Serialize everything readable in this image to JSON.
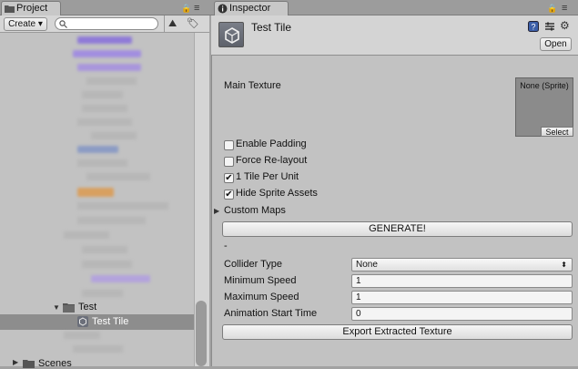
{
  "project_tab": {
    "title": "Project"
  },
  "project_toolbar": {
    "create_label": "Create"
  },
  "project_tree": {
    "folder_label": "Test",
    "selected_item_label": "Test Tile",
    "partial_label": "Scenes"
  },
  "inspector_tab": {
    "title": "Inspector"
  },
  "inspector_header": {
    "asset_title": "Test Tile",
    "open_label": "Open"
  },
  "main_texture": {
    "label": "Main Texture",
    "value": "None (Sprite)",
    "select_label": "Select"
  },
  "checkboxes": [
    {
      "label": "Enable Padding",
      "checked": false,
      "mark": ""
    },
    {
      "label": "Force Re-layout",
      "checked": false,
      "mark": ""
    },
    {
      "label": "1 Tile Per Unit",
      "checked": true,
      "mark": "✔"
    },
    {
      "label": "Hide Sprite Assets",
      "checked": true,
      "mark": "✔"
    }
  ],
  "custom_maps": {
    "label": "Custom Maps"
  },
  "generate_button": {
    "label": "GENERATE!"
  },
  "dash_text": "-",
  "collider_type": {
    "label": "Collider Type",
    "value": "None"
  },
  "minimum_speed": {
    "label": "Minimum Speed",
    "value": "1"
  },
  "maximum_speed": {
    "label": "Maximum Speed",
    "value": "1"
  },
  "animation_start_time": {
    "label": "Animation Start Time",
    "value": "0"
  },
  "export_button": {
    "label": "Export Extracted Texture"
  },
  "icons": [
    "folder-icon",
    "lock-icon",
    "menu-icon",
    "search-icon",
    "filter-icon",
    "tag-icon",
    "info-icon",
    "unity-logo-icon",
    "help-icon",
    "preset-icon",
    "gear-icon",
    "triangle-icon",
    "dropdown-arrow-icon"
  ]
}
